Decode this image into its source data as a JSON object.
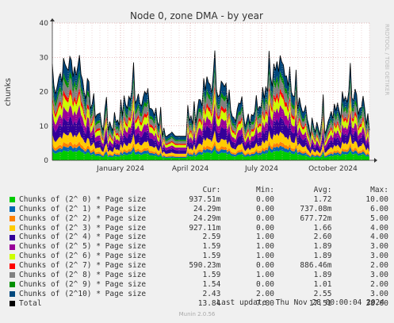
{
  "chart_data": {
    "type": "area",
    "title": "Node 0, zone DMA - by year",
    "ylabel": "chunks",
    "ylim": [
      0,
      40
    ],
    "yticks": [
      "0",
      "10",
      "20",
      "30",
      "40"
    ],
    "xticks": [
      "January 2024",
      "April 2024",
      "July 2024",
      "October 2024"
    ],
    "grid": true,
    "stacked": true,
    "series": [
      {
        "name": "Chunks of (2^ 0) * Page size",
        "color": "#00cc00",
        "cur": "937.51m",
        "min": "0.00",
        "avg": "1.72",
        "max": "10.00"
      },
      {
        "name": "Chunks of (2^ 1) * Page size",
        "color": "#0066b3",
        "cur": "24.29m",
        "min": "0.00",
        "avg": "737.08m",
        "max": "6.00"
      },
      {
        "name": "Chunks of (2^ 2) * Page size",
        "color": "#ff8000",
        "cur": "24.29m",
        "min": "0.00",
        "avg": "677.72m",
        "max": "5.00"
      },
      {
        "name": "Chunks of (2^ 3) * Page size",
        "color": "#ffcc00",
        "cur": "927.11m",
        "min": "0.00",
        "avg": "1.66",
        "max": "4.00"
      },
      {
        "name": "Chunks of (2^ 4) * Page size",
        "color": "#330099",
        "cur": "2.59",
        "min": "1.00",
        "avg": "2.60",
        "max": "4.00"
      },
      {
        "name": "Chunks of (2^ 5) * Page size",
        "color": "#990099",
        "cur": "1.59",
        "min": "1.00",
        "avg": "1.89",
        "max": "3.00"
      },
      {
        "name": "Chunks of (2^ 6) * Page size",
        "color": "#ccff00",
        "cur": "1.59",
        "min": "1.00",
        "avg": "1.89",
        "max": "3.00"
      },
      {
        "name": "Chunks of (2^ 7) * Page size",
        "color": "#ff0000",
        "cur": "590.23m",
        "min": "0.00",
        "avg": "886.46m",
        "max": "2.00"
      },
      {
        "name": "Chunks of (2^ 8) * Page size",
        "color": "#808080",
        "cur": "1.59",
        "min": "1.00",
        "avg": "1.89",
        "max": "3.00"
      },
      {
        "name": "Chunks of (2^ 9) * Page size",
        "color": "#008f00",
        "cur": "1.54",
        "min": "0.00",
        "avg": "1.01",
        "max": "2.00"
      },
      {
        "name": "Chunks of (2^10) * Page size",
        "color": "#00487d",
        "cur": "2.43",
        "min": "2.00",
        "avg": "2.55",
        "max": "3.00"
      }
    ],
    "total": {
      "name": "Total",
      "color": "#000000",
      "cur": "13.84",
      "min": "7.00",
      "avg": "17.51",
      "max": "38.00"
    }
  },
  "legend_header": {
    "cur": "Cur:",
    "min": "Min:",
    "avg": "Avg:",
    "max": "Max:"
  },
  "footer": "Last update: Thu Nov 28 00:00:04 2024",
  "watermark": "RRDTOOL / TOBI OETIKER",
  "version": "Munin 2.0.56"
}
